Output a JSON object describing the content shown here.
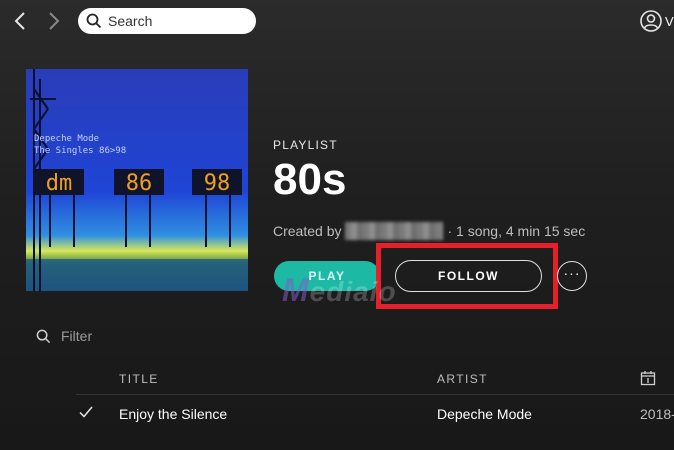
{
  "nav": {
    "back_icon": "chevron-left-icon",
    "forward_icon": "chevron-right-icon"
  },
  "search": {
    "placeholder": "Search"
  },
  "user": {
    "name": "V"
  },
  "cover": {
    "artist_text": "Depeche Mode",
    "album_text": "The Singles 86>98",
    "digits": [
      "dm",
      "86",
      "98"
    ]
  },
  "playlist": {
    "kind": "PLAYLIST",
    "title": "80s",
    "created_by_label": "Created by",
    "summary": "· 1 song, 4 min 15 sec"
  },
  "actions": {
    "play_label": "PLAY",
    "follow_label": "FOLLOW",
    "more_label": "···"
  },
  "watermark": {
    "m": "M",
    "rest": "ediaio"
  },
  "filter": {
    "placeholder": "Filter"
  },
  "tracklist": {
    "columns": {
      "title": "TITLE",
      "artist": "ARTIST",
      "date_icon": "calendar-icon"
    },
    "rows": [
      {
        "title": "Enjoy the Silence",
        "artist": "Depeche Mode",
        "date": "2018-"
      }
    ]
  },
  "colors": {
    "play_button": "#1db9a4",
    "highlight_box": "#e5202a",
    "background": "#181818"
  }
}
